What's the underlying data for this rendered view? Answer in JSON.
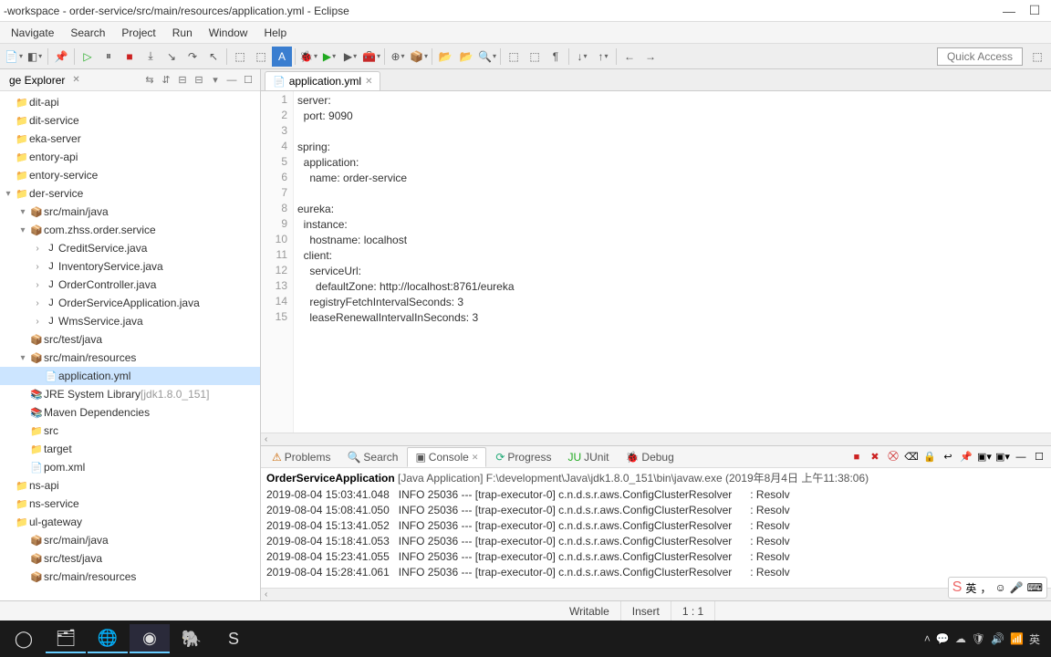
{
  "window": {
    "title": "-workspace - order-service/src/main/resources/application.yml - Eclipse"
  },
  "menu": [
    "Navigate",
    "Search",
    "Project",
    "Run",
    "Window",
    "Help"
  ],
  "quick_access": "Quick Access",
  "explorer": {
    "title": "ge Explorer",
    "nodes": [
      {
        "label": "dit-api",
        "depth": 0,
        "exp": false,
        "icon": "📁"
      },
      {
        "label": "dit-service",
        "depth": 0,
        "exp": false,
        "icon": "📁"
      },
      {
        "label": "eka-server",
        "depth": 0,
        "exp": false,
        "icon": "📁"
      },
      {
        "label": "entory-api",
        "depth": 0,
        "exp": false,
        "icon": "📁"
      },
      {
        "label": "entory-service",
        "depth": 0,
        "exp": false,
        "icon": "📁"
      },
      {
        "label": "der-service",
        "depth": 0,
        "exp": true,
        "icon": "📁"
      },
      {
        "label": "src/main/java",
        "depth": 1,
        "exp": true,
        "icon": "📦"
      },
      {
        "label": "com.zhss.order.service",
        "depth": 1,
        "exp": true,
        "icon": "📦"
      },
      {
        "label": "CreditService.java",
        "depth": 2,
        "exp": false,
        "icon": "J",
        "tw": "›"
      },
      {
        "label": "InventoryService.java",
        "depth": 2,
        "exp": false,
        "icon": "J",
        "tw": "›"
      },
      {
        "label": "OrderController.java",
        "depth": 2,
        "exp": false,
        "icon": "J",
        "tw": "›"
      },
      {
        "label": "OrderServiceApplication.java",
        "depth": 2,
        "exp": false,
        "icon": "J",
        "tw": "›"
      },
      {
        "label": "WmsService.java",
        "depth": 2,
        "exp": false,
        "icon": "J",
        "tw": "›"
      },
      {
        "label": "src/test/java",
        "depth": 1,
        "exp": false,
        "icon": "📦"
      },
      {
        "label": "src/main/resources",
        "depth": 1,
        "exp": true,
        "icon": "📦"
      },
      {
        "label": "application.yml",
        "depth": 2,
        "exp": false,
        "icon": "📄",
        "sel": true
      },
      {
        "label": "JRE System Library",
        "depth": 1,
        "exp": false,
        "icon": "📚",
        "suffix": " [jdk1.8.0_151]"
      },
      {
        "label": "Maven Dependencies",
        "depth": 1,
        "exp": false,
        "icon": "📚"
      },
      {
        "label": "src",
        "depth": 1,
        "exp": false,
        "icon": "📁"
      },
      {
        "label": "target",
        "depth": 1,
        "exp": false,
        "icon": "📁"
      },
      {
        "label": "pom.xml",
        "depth": 1,
        "exp": false,
        "icon": "📄"
      },
      {
        "label": "ns-api",
        "depth": 0,
        "exp": false,
        "icon": "📁"
      },
      {
        "label": "ns-service",
        "depth": 0,
        "exp": false,
        "icon": "📁"
      },
      {
        "label": "ul-gateway",
        "depth": 0,
        "exp": false,
        "icon": "📁"
      },
      {
        "label": "src/main/java",
        "depth": 1,
        "exp": false,
        "icon": "📦"
      },
      {
        "label": "src/test/java",
        "depth": 1,
        "exp": false,
        "icon": "📦"
      },
      {
        "label": "src/main/resources",
        "depth": 1,
        "exp": false,
        "icon": "📦"
      }
    ]
  },
  "editor": {
    "tab": "application.yml",
    "lines": [
      "server:",
      "  port: 9090",
      "",
      "spring:",
      "  application:",
      "    name: order-service",
      "",
      "eureka:",
      "  instance:",
      "    hostname: localhost",
      "  client:",
      "    serviceUrl:",
      "      defaultZone: http://localhost:8761/eureka",
      "    registryFetchIntervalSeconds: 3",
      "    leaseRenewalIntervalInSeconds: 3"
    ]
  },
  "bottom": {
    "tabs": {
      "problems": "Problems",
      "search": "Search",
      "console": "Console",
      "progress": "Progress",
      "junit": "JUnit",
      "debug": "Debug"
    },
    "header_app": "OrderServiceApplication",
    "header_det": " [Java Application] F:\\development\\Java\\jdk1.8.0_151\\bin\\javaw.exe (2019年8月4日 上午11:38:06)",
    "lines": [
      "2019-08-04 15:03:41.048   INFO 25036 --- [trap-executor-0] c.n.d.s.r.aws.ConfigClusterResolver      : Resolv",
      "2019-08-04 15:08:41.050   INFO 25036 --- [trap-executor-0] c.n.d.s.r.aws.ConfigClusterResolver      : Resolv",
      "2019-08-04 15:13:41.052   INFO 25036 --- [trap-executor-0] c.n.d.s.r.aws.ConfigClusterResolver      : Resolv",
      "2019-08-04 15:18:41.053   INFO 25036 --- [trap-executor-0] c.n.d.s.r.aws.ConfigClusterResolver      : Resolv",
      "2019-08-04 15:23:41.055   INFO 25036 --- [trap-executor-0] c.n.d.s.r.aws.ConfigClusterResolver      : Resolv",
      "2019-08-04 15:28:41.061   INFO 25036 --- [trap-executor-0] c.n.d.s.r.aws.ConfigClusterResolver      : Resolv"
    ]
  },
  "status": {
    "writable": "Writable",
    "insert": "Insert",
    "pos": "1 : 1"
  },
  "ime": "英"
}
